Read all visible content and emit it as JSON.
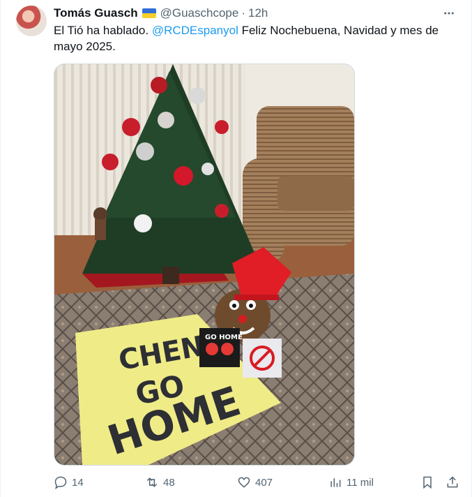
{
  "author": {
    "name": "Tomás Guasch",
    "handle": "@Guaschcope",
    "separator": "·",
    "time": "12h"
  },
  "tweet": {
    "text_before": "El Tió ha hablado. ",
    "mention": "@RCDEspanyol",
    "text_after": " Feliz Nochebuena, Navidad y mes de mayo 2025."
  },
  "media": {
    "banner_lines": [
      "CHEN",
      "GO",
      "HOME"
    ],
    "sign_title": "GO HOME"
  },
  "actions": {
    "replies": "14",
    "reposts": "48",
    "likes": "407",
    "views": "11 mil"
  },
  "colors": {
    "accent": "#1d9bf0",
    "secondary_text": "#536471"
  }
}
